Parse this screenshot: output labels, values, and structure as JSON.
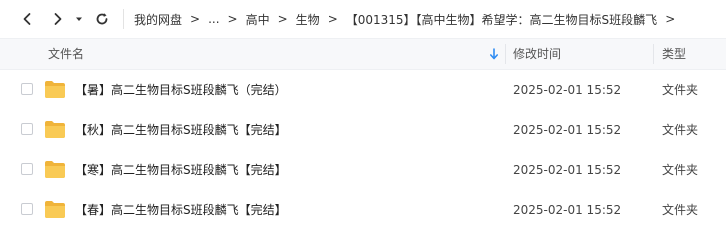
{
  "toolbar": {
    "back_icon": "chevron-left-icon",
    "forward_icon": "chevron-right-icon",
    "dropdown_icon": "caret-down-icon",
    "refresh_icon": "refresh-icon"
  },
  "breadcrumb": {
    "items": [
      "我的网盘",
      "...",
      "高中",
      "生物",
      "【001315】【高中生物】希望学：高二生物目标S班段麟飞"
    ],
    "separator": ">"
  },
  "table": {
    "headers": {
      "name": "文件名",
      "modified": "修改时间",
      "type": "类型"
    },
    "sort_icon": "sort-down-arrow-icon",
    "rows": [
      {
        "name": "【暑】高二生物目标S班段麟飞（完结）",
        "modified": "2025-02-01 15:52",
        "type": "文件夹",
        "icon": "folder-icon"
      },
      {
        "name": "【秋】高二生物目标S班段麟飞【完结】",
        "modified": "2025-02-01 15:52",
        "type": "文件夹",
        "icon": "folder-icon"
      },
      {
        "name": "【寒】高二生物目标S班段麟飞【完结】",
        "modified": "2025-02-01 15:52",
        "type": "文件夹",
        "icon": "folder-icon"
      },
      {
        "name": "【春】高二生物目标S班段麟飞【完结】",
        "modified": "2025-02-01 15:52",
        "type": "文件夹",
        "icon": "folder-icon"
      }
    ]
  },
  "colors": {
    "folder": "#f7c34a",
    "accent": "#2f8cf2"
  }
}
